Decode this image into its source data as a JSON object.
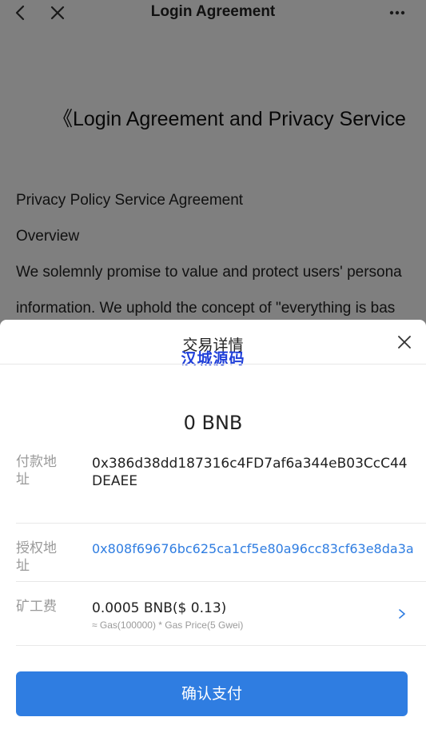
{
  "header": {
    "title": "Login Agreement",
    "back_icon": "chevron-left-icon",
    "close_icon": "close-icon",
    "more_icon": "more-horizontal-icon"
  },
  "document": {
    "heading": "《Login Agreement and Privacy Service",
    "lines": [
      "Privacy Policy Service Agreement",
      "Overview",
      "We solemnly promise to value and protect users' persona",
      "information. We uphold the concept of \"everything is bas"
    ]
  },
  "sheet": {
    "title": "交易详情",
    "watermark": "汉城源码",
    "close_icon": "close-icon",
    "amount": "0 BNB",
    "payment_address": {
      "label": "付款地址",
      "value": "0x386d38dd187316c4FD7af6a344eB03CcC44DEAEE"
    },
    "authorized_address": {
      "label": "授权地址",
      "value": "0x808f69676bc625ca1cf5e80a96cc83cf63e8da3a"
    },
    "miner_fee": {
      "label": "矿工费",
      "value": "0.0005 BNB($ 0.13)",
      "detail": "≈ Gas(100000) * Gas Price(5 Gwei)",
      "chevron_icon": "chevron-right-icon"
    },
    "confirm_button": "确认支付"
  },
  "colors": {
    "accent": "#2f7de1",
    "watermark": "#1f3fd9",
    "overlay": "rgba(0,0,0,0.5)"
  }
}
